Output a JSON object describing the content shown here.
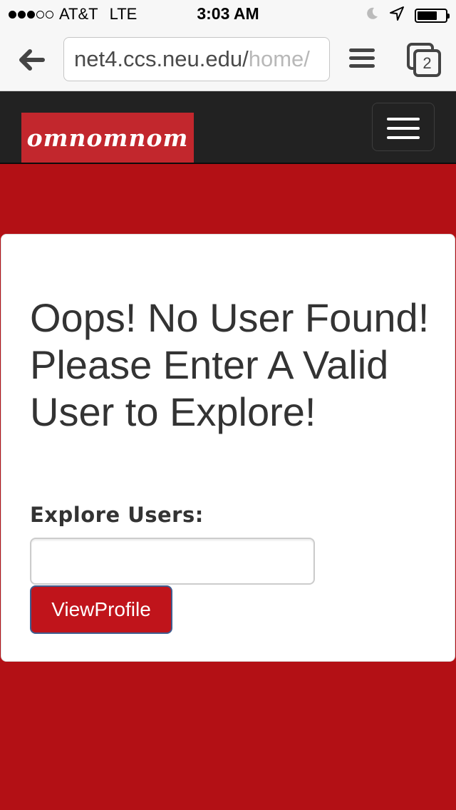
{
  "status_bar": {
    "carrier": "AT&T",
    "network": "LTE",
    "time": "3:03 AM",
    "signal_bars_filled": 3,
    "signal_bars_total": 5,
    "battery_level": 0.7
  },
  "browser": {
    "url_main": "net4.ccs.neu.edu/",
    "url_faded": "home/",
    "tab_count": "2"
  },
  "navbar": {
    "brand": "omnomnom"
  },
  "main": {
    "headline": "Oops! No User Found! Please Enter A Valid User to Explore!",
    "field_label": "Explore Users:",
    "search_value": "",
    "button_label": "ViewProfile"
  },
  "colors": {
    "page_background": "#b31015",
    "navbar_background": "#222222",
    "brand_background": "#c2272d",
    "button_background": "#c0141b"
  },
  "icons": [
    "back-arrow-icon",
    "menu-icon",
    "tabs-icon",
    "moon-icon",
    "location-arrow-icon",
    "battery-icon",
    "hamburger-icon"
  ]
}
